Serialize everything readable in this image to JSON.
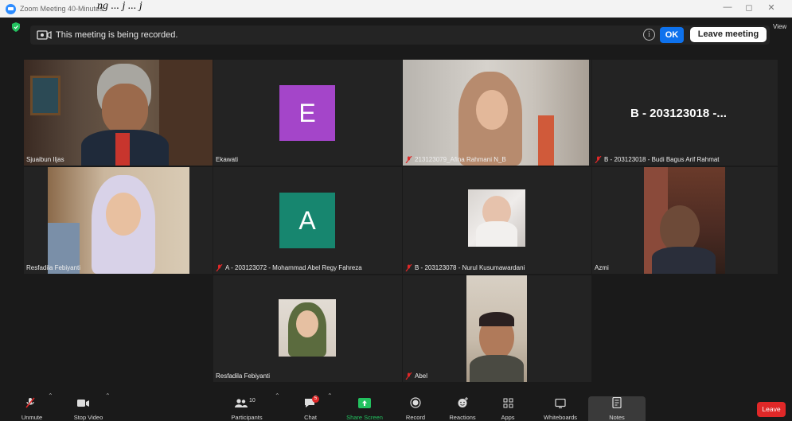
{
  "window": {
    "title": "Zoom Meeting 40-Minutes",
    "overlay_text": "ng ... j ... j"
  },
  "banner": {
    "recording_text": "This meeting is being recorded.",
    "info_symbol": "i",
    "ok_label": "OK",
    "leave_meeting_label": "Leave meeting",
    "view_label": "View"
  },
  "tiles": [
    {
      "name": "Sjuaibun Iljas",
      "muted": false,
      "active_speaker": true
    },
    {
      "name": "Ekawati",
      "initial": "E",
      "avatar_color": "#a445c9",
      "muted": false
    },
    {
      "name": "213123079_Afina Rahmani N_B",
      "muted": true
    },
    {
      "name": "B - 203123018 - Budi Bagus Arif Rahmat",
      "display_name": "B - 203123018 -...",
      "muted": true
    },
    {
      "name": "Resfadila Febiyanti",
      "muted": false
    },
    {
      "name": "A - 203123072 - Mohammad Abel Regy Fahreza",
      "initial": "A",
      "avatar_color": "#17866f",
      "muted": true
    },
    {
      "name": "B - 203123078 - Nurul Kusumawardani",
      "muted": true
    },
    {
      "name": "Azmi",
      "muted": false
    },
    {
      "name": "Resfadila Febiyanti",
      "muted": false
    },
    {
      "name": "Abel",
      "muted": true
    }
  ],
  "toolbar": {
    "unmute": "Unmute",
    "stop_video": "Stop Video",
    "participants": "Participants",
    "participants_count": "10",
    "chat": "Chat",
    "chat_badge": "5",
    "share_screen": "Share Screen",
    "record": "Record",
    "reactions": "Reactions",
    "apps": "Apps",
    "whiteboards": "Whiteboards",
    "notes": "Notes",
    "leave": "Leave"
  },
  "colors": {
    "accent": "#0e72ed",
    "share_green": "#23c15f",
    "leave_red": "#e02828",
    "speaker_outline": "#d6e45a"
  }
}
